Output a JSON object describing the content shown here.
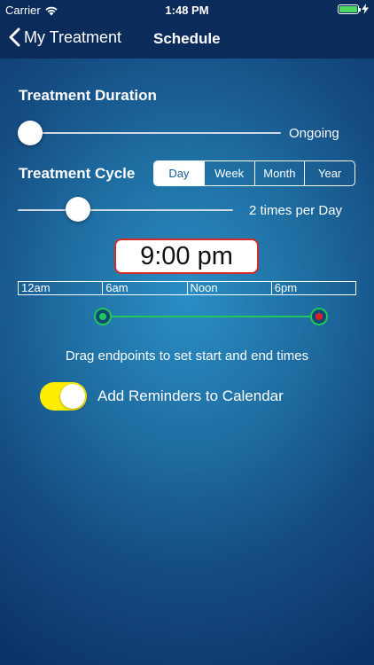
{
  "status_bar": {
    "carrier": "Carrier",
    "time": "1:48 PM",
    "battery_color": "#4cd964"
  },
  "nav": {
    "back_label": "My Treatment",
    "title": "Schedule"
  },
  "duration": {
    "title": "Treatment Duration",
    "value_label": "Ongoing",
    "slider_fraction": 0.0
  },
  "cycle": {
    "title": "Treatment Cycle",
    "segments": [
      "Day",
      "Week",
      "Month",
      "Year"
    ],
    "selected": "Day",
    "frequency_label": "2 times per Day",
    "slider_fraction": 0.27
  },
  "schedule": {
    "selected_time": "9:00 pm",
    "timeline_labels": [
      "12am",
      "6am",
      "Noon",
      "6pm"
    ],
    "start_color": "#22c55e",
    "end_color": "#e11d2a"
  },
  "hint": "Drag endpoints to set start and end times",
  "reminders": {
    "label": "Add Reminders to Calendar",
    "enabled": true,
    "toggle_color": "#ffee00"
  }
}
